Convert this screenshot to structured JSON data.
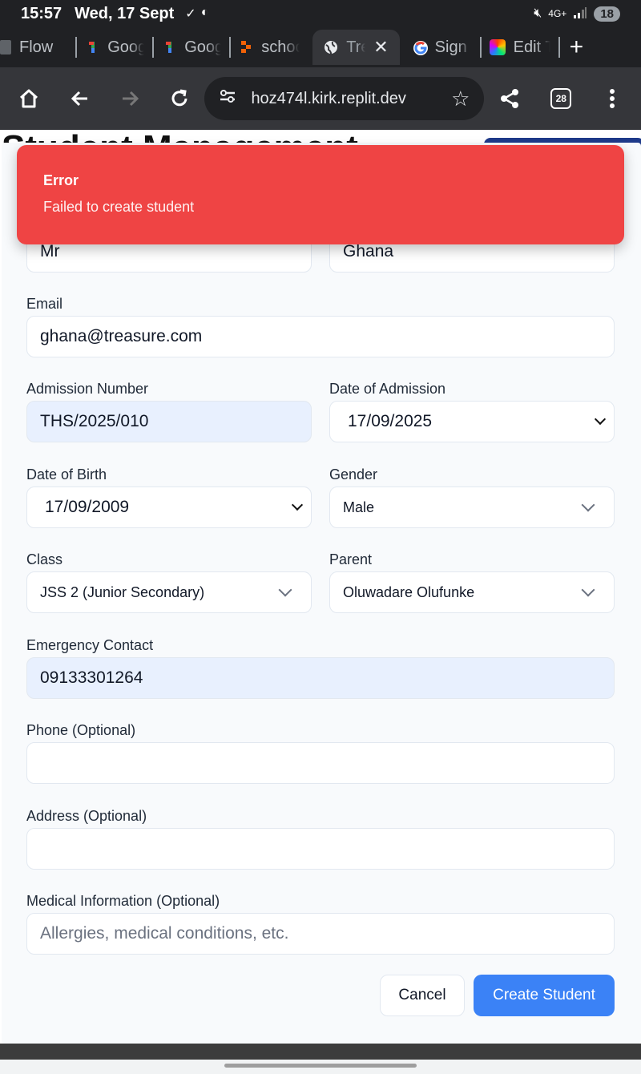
{
  "status_bar": {
    "time": "15:57",
    "date": "Wed, 17 Sept",
    "network": "4G+",
    "battery": "18"
  },
  "tabs": [
    {
      "label": "Flow",
      "icon": "flow-icon"
    },
    {
      "label": "Goog",
      "icon": "google-one-icon"
    },
    {
      "label": "Goog",
      "icon": "google-one-icon"
    },
    {
      "label": "schoo",
      "icon": "replit-icon"
    },
    {
      "label": "Tre",
      "icon": "globe-icon",
      "active": true
    },
    {
      "label": "Sign i",
      "icon": "google-g-icon"
    },
    {
      "label": "Edit T",
      "icon": "colorful-app-icon"
    }
  ],
  "toolbar": {
    "url": "hoz474l.kirk.replit.dev",
    "tab_count": "28"
  },
  "page": {
    "heading": "Student Management"
  },
  "toast": {
    "title": "Error",
    "message": "Failed to create student",
    "color": "#ef4444"
  },
  "form": {
    "first_name_value": "Mr",
    "last_name_value": "Ghana",
    "email_label": "Email",
    "email_value": "ghana@treasure.com",
    "admission_number_label": "Admission Number",
    "admission_number_value": "THS/2025/010",
    "date_of_admission_label": "Date of Admission",
    "date_of_admission_value": "17/09/2025",
    "date_of_birth_label": "Date of Birth",
    "date_of_birth_value": "17/09/2009",
    "gender_label": "Gender",
    "gender_value": "Male",
    "class_label": "Class",
    "class_value": "JSS 2 (Junior Secondary)",
    "parent_label": "Parent",
    "parent_value": "Oluwadare Olufunke",
    "emergency_contact_label": "Emergency Contact",
    "emergency_contact_value": "09133301264",
    "phone_label": "Phone (Optional)",
    "phone_value": "",
    "address_label": "Address (Optional)",
    "address_value": "",
    "medical_label": "Medical Information (Optional)",
    "medical_placeholder": "Allergies, medical conditions, etc.",
    "cancel_label": "Cancel",
    "create_label": "Create Student",
    "accent_color": "#3b82f6"
  }
}
